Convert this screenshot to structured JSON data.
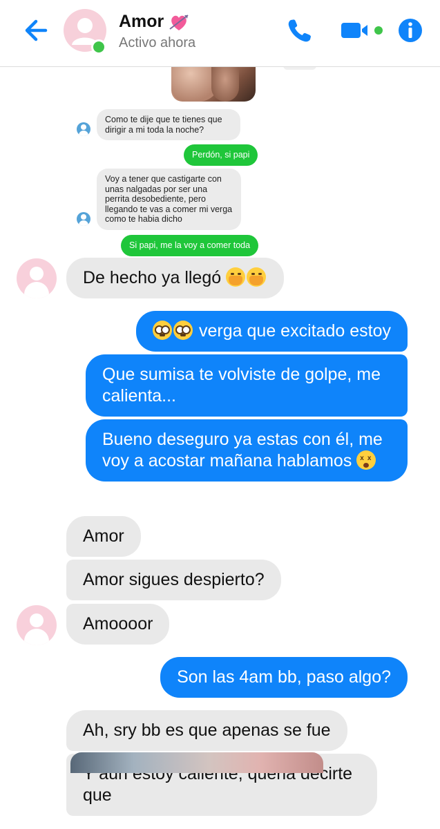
{
  "header": {
    "contact_name": "Amor",
    "status": "Activo ahora",
    "icons": [
      "back-arrow-icon",
      "phone-icon",
      "video-camera-icon",
      "info-icon",
      "heart-with-arrow-emoji"
    ],
    "colors": {
      "accent": "#0f84fa",
      "online": "#3fc54a",
      "avatar_bg": "#f8d0db"
    }
  },
  "small_messages": [
    {
      "side": "received",
      "text": "Como te dije que te tienes que dirigir a mi toda la noche?"
    },
    {
      "side": "sent",
      "text": "Perdón, si papi"
    },
    {
      "side": "received",
      "text": "Voy a tener que castigarte con unas nalgadas por ser una perrita desobediente, pero llegando te vas a comer mi verga como te habia dicho"
    },
    {
      "side": "sent",
      "text": "Si papi, me la voy a comer toda"
    }
  ],
  "messages": [
    {
      "side": "received",
      "text": "De hecho ya llegó",
      "emoji": [
        "shy",
        "shy"
      ]
    },
    {
      "side": "sent",
      "text": "verga que excitado estoy",
      "emoji": [
        "flushed",
        "flushed"
      ]
    },
    {
      "side": "sent",
      "text": "Que sumisa te volviste de golpe, me calienta..."
    },
    {
      "side": "sent",
      "text": "Bueno deseguro ya estas con él, me voy a acostar mañana hablamos",
      "emoji": [
        "dizzy"
      ]
    },
    {
      "side": "received",
      "text": "Amor"
    },
    {
      "side": "received",
      "text": "Amor sigues despierto?"
    },
    {
      "side": "received",
      "text": "Amoooor"
    },
    {
      "side": "sent",
      "text": "Son las 4am bb, paso algo?"
    },
    {
      "side": "received",
      "text": "Ah, sry bb es que apenas se fue"
    },
    {
      "side": "received",
      "text": "Y aun estoy caliente, queria decirte que"
    }
  ]
}
